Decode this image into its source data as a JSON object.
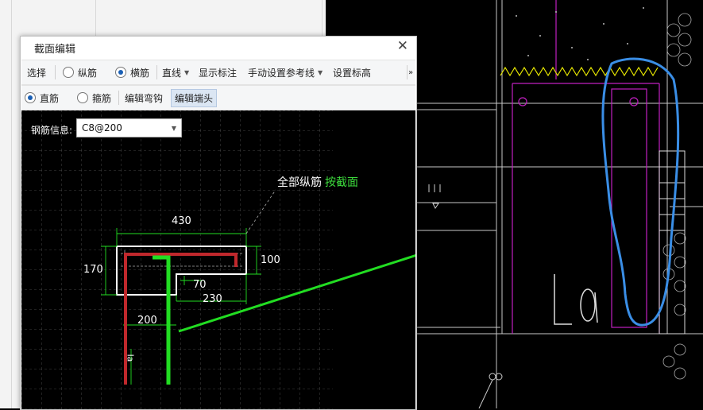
{
  "dialog": {
    "title": "截面编辑",
    "close_icon": "close-icon"
  },
  "toolbar1": {
    "select": "选择",
    "longitudinal": "纵筋",
    "transverse": "横筋",
    "line": "直线",
    "show_dims": "显示标注",
    "manual_ref": "手动设置参考线",
    "set_elevation": "设置标高",
    "more": "»",
    "selected_radio": "transverse"
  },
  "toolbar2": {
    "straight": "直筋",
    "stirrup": "箍筋",
    "edit_hook": "编辑弯钩",
    "edit_end": "编辑端头",
    "selected_radio": "straight"
  },
  "canvas": {
    "rebar_label": "钢筋信息:",
    "rebar_value": "C8@200",
    "annotation": "全部纵筋",
    "annotation_link": "按截面",
    "dims": {
      "width": "430",
      "height_left": "170",
      "height_right": "100",
      "step": "70",
      "offset": "230",
      "bottom": "200",
      "vertical": "la"
    }
  },
  "cad_view": {
    "label": "La"
  },
  "colors": {
    "accent": "#1a5fb4",
    "highlight_green": "#22dd22",
    "rebar_red": "#c0282c",
    "cad_magenta": "#c020c0",
    "annotation_blue": "#3a8ee6"
  }
}
